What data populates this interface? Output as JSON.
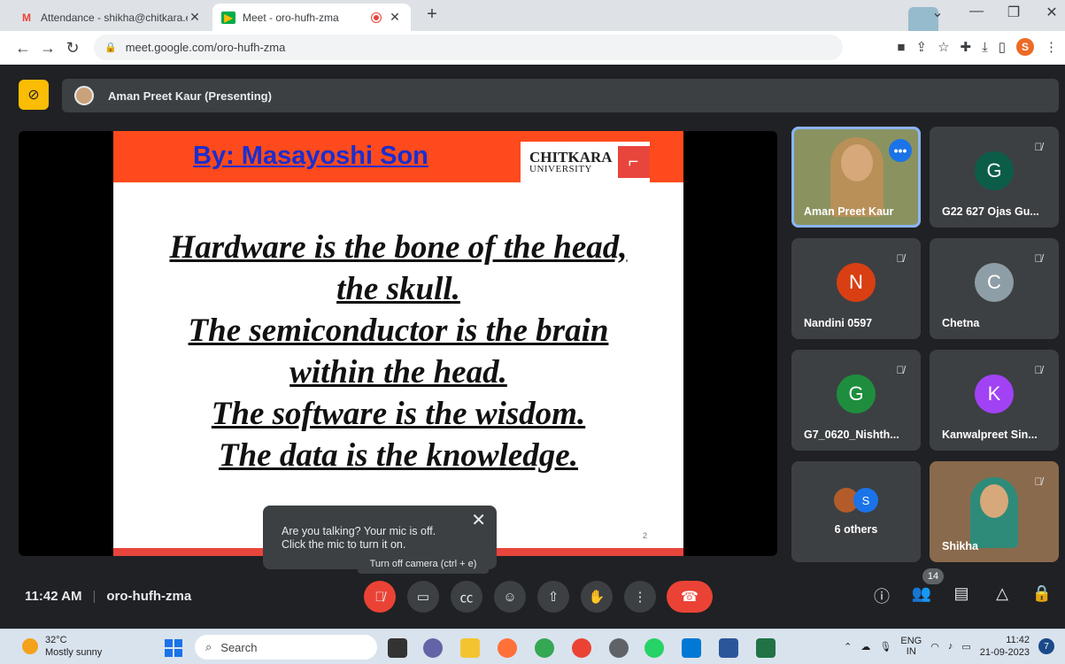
{
  "browser": {
    "tabs": [
      {
        "title": "Attendance - shikha@chitkara.ed",
        "favicon": "gmail-icon"
      },
      {
        "title": "Meet - oro-hufh-zma",
        "favicon": "meet-icon",
        "recording": true
      }
    ],
    "url": "meet.google.com/oro-hufh-zma",
    "profile_initial": "S"
  },
  "meet": {
    "presenting_label": "Aman Preet Kaur (Presenting)",
    "slide": {
      "author": "By: Masayoshi Son",
      "logo_line1": "CHITKARA",
      "logo_line2": "UNIVERSITY",
      "quote_lines": [
        "Hardware is the bone of the head,",
        "the skull.",
        "The semiconductor is the brain",
        "within the head.",
        "The software is the wisdom.",
        "The data is the knowledge."
      ],
      "page_number": "2"
    },
    "mic_tooltip": {
      "line1": "Are you talking? Your mic is off.",
      "line2": "Click the mic to turn it on."
    },
    "camera_tooltip": "Turn off camera (ctrl + e)",
    "participants": [
      {
        "name": "Aman Preet Kaur"
      },
      {
        "name": "G22 627 Ojas Gu...",
        "initial": "G",
        "color": "#0b5d4a"
      },
      {
        "name": "Nandini 0597",
        "initial": "N",
        "color": "#d93f13"
      },
      {
        "name": "Chetna",
        "initial": "C",
        "color": "#8e9ea6"
      },
      {
        "name": "G7_0620_Nishth...",
        "initial": "G",
        "color": "#1e8e3e"
      },
      {
        "name": "Kanwalpreet Sin...",
        "initial": "K",
        "color": "#a142f4"
      },
      {
        "name": "6 others",
        "initial": "S"
      },
      {
        "name": "Shikha"
      }
    ],
    "time": "11:42 AM",
    "meeting_code": "oro-hufh-zma",
    "people_count": "14"
  },
  "taskbar": {
    "temperature": "32°C",
    "weather": "Mostly sunny",
    "search_placeholder": "Search",
    "lang_line1": "ENG",
    "lang_line2": "IN",
    "time": "11:42",
    "date": "21-09-2023",
    "notifications": "7"
  }
}
